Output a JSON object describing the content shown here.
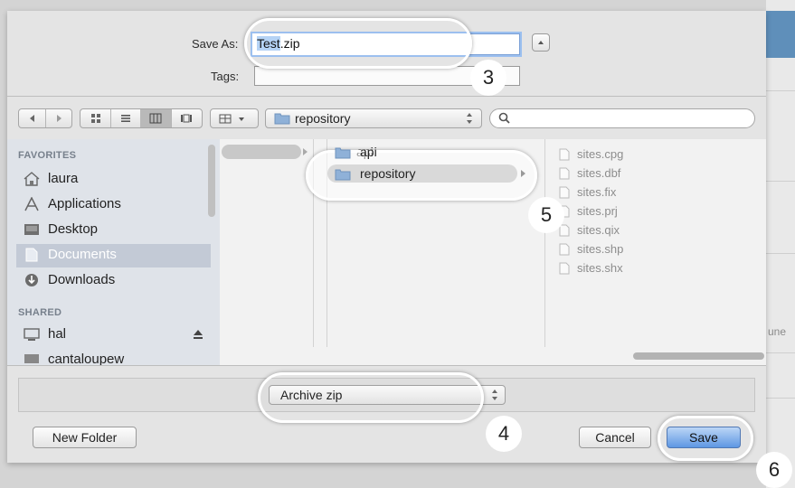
{
  "save_as": {
    "label": "Save As:",
    "value": "Test.zip"
  },
  "tags": {
    "label": "Tags:",
    "value": ""
  },
  "toolbar": {
    "location": "repository",
    "search_placeholder": ""
  },
  "sidebar": {
    "favorites_header": "FAVORITES",
    "favorites": [
      {
        "label": "laura",
        "icon": "home-icon"
      },
      {
        "label": "Applications",
        "icon": "applications-icon"
      },
      {
        "label": "Desktop",
        "icon": "desktop-icon"
      },
      {
        "label": "Documents",
        "icon": "documents-icon",
        "selected": true
      },
      {
        "label": "Downloads",
        "icon": "downloads-icon"
      }
    ],
    "shared_header": "SHARED",
    "shared": [
      {
        "label": "hal",
        "icon": "computer-icon"
      },
      {
        "label": "cantaloupew",
        "icon": "computer-icon"
      }
    ]
  },
  "columns": {
    "middle": [
      "api",
      "repository"
    ],
    "files": [
      "sites.cpg",
      "sites.dbf",
      "sites.fix",
      "sites.prj",
      "sites.qix",
      "sites.shp",
      "sites.shx"
    ]
  },
  "format": {
    "value": "Archive zip"
  },
  "buttons": {
    "new_folder": "New Folder",
    "cancel": "Cancel",
    "save": "Save"
  },
  "callouts": [
    "3",
    "4",
    "5",
    "6"
  ],
  "background_app": {
    "partial_text": "une"
  },
  "colors": {
    "accent": "#5e97e3",
    "selection": "#b5d3f5"
  }
}
